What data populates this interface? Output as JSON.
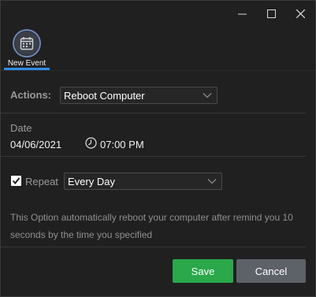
{
  "window": {
    "minimize_icon": "minimize-icon",
    "maximize_icon": "maximize-icon",
    "close_icon": "close-icon"
  },
  "toolbar": {
    "new_event_label": "New Event",
    "new_event_icon": "calendar-icon",
    "accent_color": "#2f8ee5"
  },
  "form": {
    "actions_label": "Actions:",
    "actions_value": "Reboot Computer",
    "date_label": "Date",
    "date_value": "04/06/2021",
    "time_value": "07:00 PM",
    "repeat_checked": true,
    "repeat_label": "Repeat",
    "repeat_value": "Every Day",
    "note": "This Option automatically reboot your computer after remind you 10 seconds by the time you specified"
  },
  "buttons": {
    "save_label": "Save",
    "save_color": "#2aa84a",
    "cancel_label": "Cancel",
    "cancel_color": "#5d6168"
  }
}
